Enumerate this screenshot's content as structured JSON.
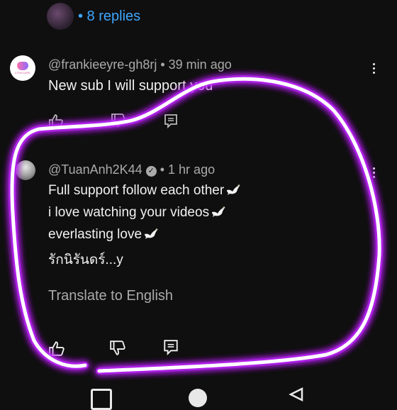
{
  "thread": {
    "replies_label": "• 8 replies"
  },
  "comment1": {
    "author": "@frankieeyre-gh8rj",
    "time": "• 39 min ago",
    "text": "New sub I will support you",
    "avatar_text": "LOVECARE"
  },
  "comment2": {
    "author": "@TuanAnh2K44",
    "time": "• 1 hr ago",
    "lines": [
      "Full support follow each other",
      "i love watching your videos",
      "everlasting love",
      "รักนิรันดร์...y"
    ],
    "translate": "Translate to English"
  },
  "icons": {
    "like": "thumb-up-icon",
    "dislike": "thumb-down-icon",
    "reply": "reply-icon",
    "menu": "more-vert-icon",
    "verified": "verified-check-icon",
    "dove": "dove-emoji-icon"
  },
  "colors": {
    "background": "#0f0f0f",
    "link_blue": "#3ea6ff",
    "highlight_glow": "#c020ff"
  }
}
